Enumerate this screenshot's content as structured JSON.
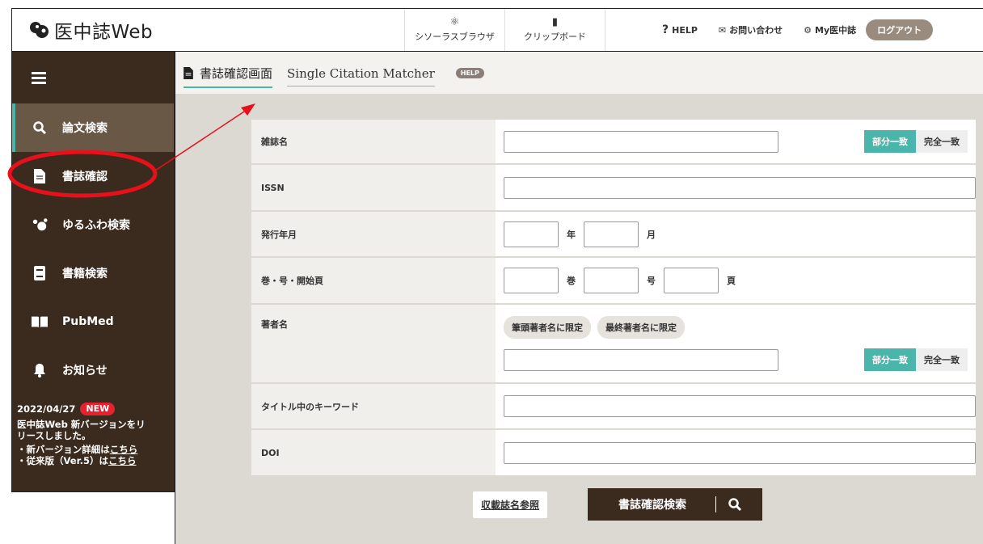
{
  "header": {
    "logo_text": "医中誌Web",
    "tools": [
      {
        "icon": "thesaurus-icon",
        "label": "シソーラスブラウザ"
      },
      {
        "icon": "clipboard-icon",
        "label": "クリップボード"
      }
    ],
    "help": "HELP",
    "contact": "お問い合わせ",
    "my": "My医中誌",
    "logout": "ログアウト"
  },
  "sidebar": {
    "items": [
      {
        "label": "論文検索",
        "icon": "search-icon"
      },
      {
        "label": "書誌確認",
        "icon": "document-icon"
      },
      {
        "label": "ゆるふわ検索",
        "icon": "bubbles-icon"
      },
      {
        "label": "書籍検索",
        "icon": "book-icon"
      },
      {
        "label": "PubMed",
        "icon": "open-book-icon"
      },
      {
        "label": "お知らせ",
        "icon": "bell-icon"
      }
    ],
    "news": {
      "date": "2022/04/27",
      "badge": "NEW",
      "text": "医中誌Web 新バージョンをリリースしました。",
      "line1_prefix": "・新バージョン詳細は",
      "line1_link": "こちら",
      "line2_prefix": "・従来版（Ver.5）は",
      "line2_link": "こちら"
    }
  },
  "main": {
    "title": "書誌確認画面",
    "subtitle": "Single Citation Matcher",
    "help_pill": "HELP",
    "fields": {
      "journal": "雑誌名",
      "issn": "ISSN",
      "pubdate": "発行年月",
      "year_unit": "年",
      "month_unit": "月",
      "vol_issue_page": "巻・号・開始頁",
      "vol_unit": "巻",
      "issue_unit": "号",
      "page_unit": "頁",
      "author": "著者名",
      "first_author": "筆頭著者名に限定",
      "last_author": "最終著者名に限定",
      "title_kw": "タイトル中のキーワード",
      "doi": "DOI"
    },
    "match": {
      "partial": "部分一致",
      "exact": "完全一致"
    },
    "ref_button": "収載誌名参照",
    "search_button": "書誌確認検索"
  },
  "colors": {
    "accent": "#4ab5aa",
    "sidebar": "#3b2b1e",
    "annotation": "#e8101a"
  }
}
